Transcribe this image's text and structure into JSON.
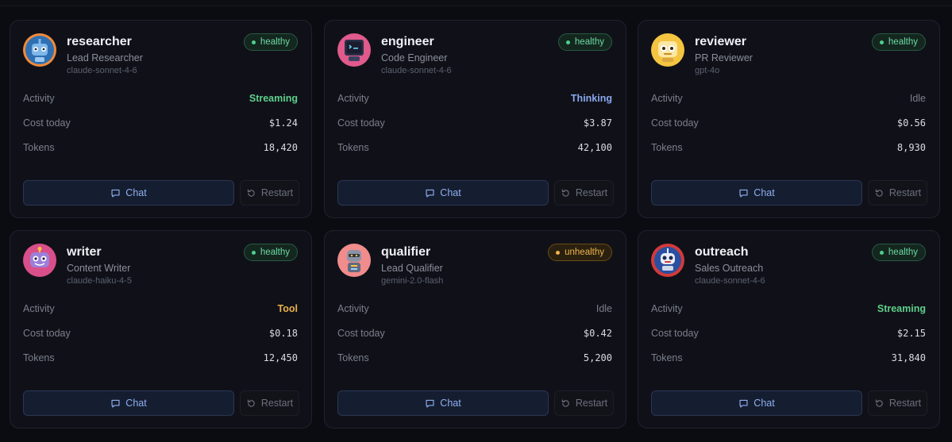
{
  "labels": {
    "activity": "Activity",
    "cost": "Cost today",
    "tokens": "Tokens",
    "chat": "Chat",
    "restart": "Restart"
  },
  "agents": [
    {
      "name": "researcher",
      "role": "Lead Researcher",
      "model": "claude-sonnet-4-6",
      "status": "healthy",
      "activity": "Streaming",
      "cost": "$1.24",
      "tokens": "18,420",
      "avatar_icon": "robot-avatar-blue-icon"
    },
    {
      "name": "engineer",
      "role": "Code Engineer",
      "model": "claude-sonnet-4-6",
      "status": "healthy",
      "activity": "Thinking",
      "cost": "$3.87",
      "tokens": "42,100",
      "avatar_icon": "robot-avatar-screen-icon"
    },
    {
      "name": "reviewer",
      "role": "PR Reviewer",
      "model": "gpt-4o",
      "status": "healthy",
      "activity": "Idle",
      "cost": "$0.56",
      "tokens": "8,930",
      "avatar_icon": "robot-avatar-yellow-icon"
    },
    {
      "name": "writer",
      "role": "Content Writer",
      "model": "claude-haiku-4-5",
      "status": "healthy",
      "activity": "Tool",
      "cost": "$0.18",
      "tokens": "12,450",
      "avatar_icon": "robot-avatar-purple-icon"
    },
    {
      "name": "qualifier",
      "role": "Lead Qualifier",
      "model": "gemini-2.0-flash",
      "status": "unhealthy",
      "activity": "Idle",
      "cost": "$0.42",
      "tokens": "5,200",
      "avatar_icon": "robot-avatar-pink-icon"
    },
    {
      "name": "outreach",
      "role": "Sales Outreach",
      "model": "claude-sonnet-4-6",
      "status": "healthy",
      "activity": "Streaming",
      "cost": "$2.15",
      "tokens": "31,840",
      "avatar_icon": "robot-avatar-red-icon"
    }
  ],
  "colors": {
    "healthy": "#6ed9a3",
    "unhealthy": "#f0b44a",
    "streaming": "#5ecf8a",
    "thinking": "#8aa7ee",
    "tool": "#e9b14a",
    "accent": "#8fb0f0"
  }
}
